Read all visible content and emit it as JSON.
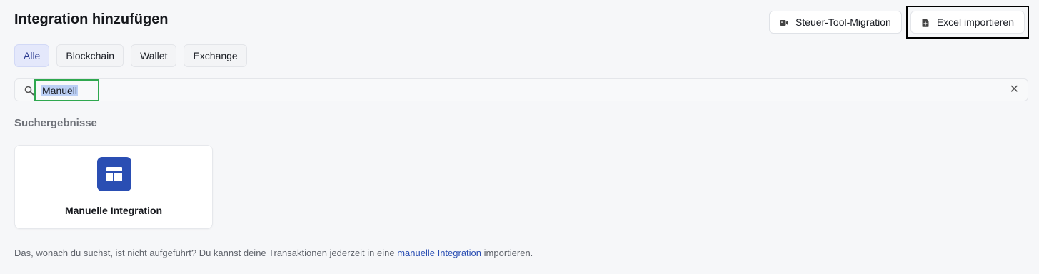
{
  "header": {
    "title": "Integration hinzufügen"
  },
  "actions": {
    "migration_label": "Steuer-Tool-Migration",
    "excel_label": "Excel importieren"
  },
  "filters": [
    {
      "label": "Alle",
      "active": true
    },
    {
      "label": "Blockchain",
      "active": false
    },
    {
      "label": "Wallet",
      "active": false
    },
    {
      "label": "Exchange",
      "active": false
    }
  ],
  "search": {
    "value": "Manuell",
    "clear_icon": "close-icon"
  },
  "results": {
    "section_label": "Suchergebnisse",
    "items": [
      {
        "name": "Manuelle Integration",
        "icon": "table-layout-icon",
        "color": "#2a4eb3"
      }
    ]
  },
  "footnote": {
    "before": "Das, wonach du suchst, ist nicht aufgeführt? Du kannst deine Transaktionen jederzeit in eine ",
    "link": "manuelle Integration",
    "after": " importieren."
  },
  "colors": {
    "accent": "#2a4eb3",
    "selection_highlight": "#bcd0f5",
    "focus_box": "#2fa84f"
  }
}
